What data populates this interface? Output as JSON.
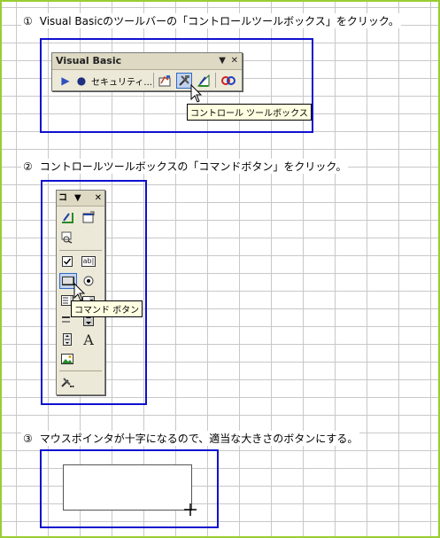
{
  "steps": [
    {
      "number": "①",
      "text": "Visual Basicのツールバーの「コントロールツールボックス」をクリック。"
    },
    {
      "number": "②",
      "text": "コントロールツールボックスの「コマンドボタン」をクリック。"
    },
    {
      "number": "③",
      "text": "マウスポインタが十字になるので、適当な大きさのボタンにする。"
    }
  ],
  "vb_toolbar": {
    "title": "Visual Basic",
    "dropdown_glyph": "▼",
    "close_glyph": "✕",
    "security_label": "セキュリティ...",
    "tooltip": "コントロール ツールボックス"
  },
  "control_toolbox": {
    "title": "コ",
    "dropdown_glyph": "▼",
    "close_glyph": "✕",
    "tooltip": "コマンド ボタン",
    "label_icon_text": "ab|",
    "label_control_glyph": "A"
  },
  "colors": {
    "frame": "#1010d0",
    "outer_border": "#9acd32",
    "toolbar_bg": "#ece9d8",
    "pressed_bg": "#c1d2ee",
    "tooltip_bg": "#ffffe1"
  }
}
